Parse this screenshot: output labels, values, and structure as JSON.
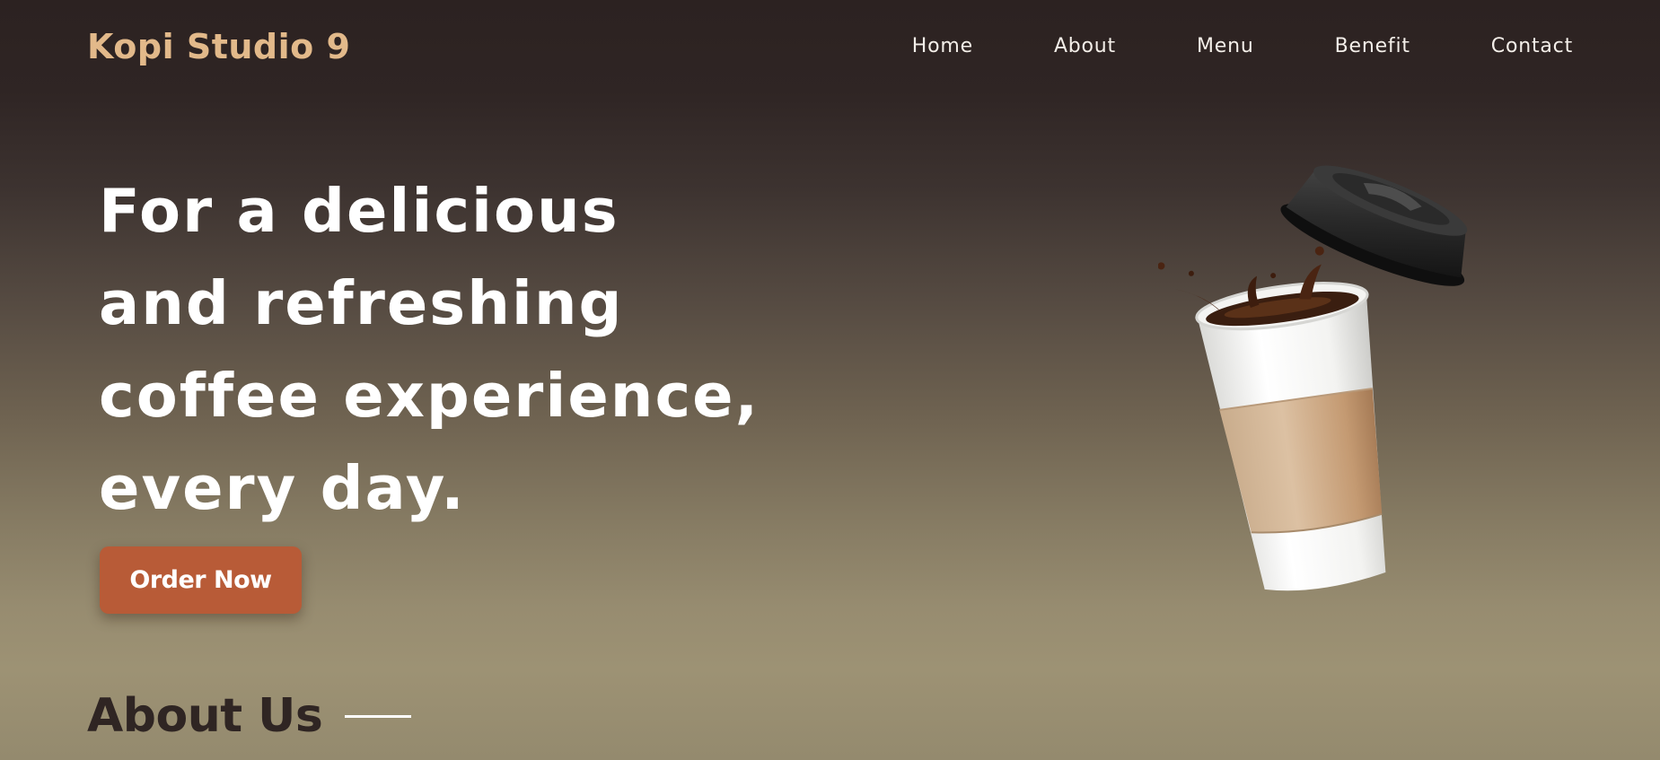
{
  "header": {
    "brand": "Kopi Studio 9",
    "nav": [
      {
        "label": "Home"
      },
      {
        "label": "About"
      },
      {
        "label": "Menu"
      },
      {
        "label": "Benefit"
      },
      {
        "label": "Contact"
      }
    ]
  },
  "hero": {
    "title_lines": [
      "For a delicious",
      "and refreshing",
      "coffee experience,",
      "every day."
    ],
    "cta_label": "Order Now",
    "image": {
      "icon": "coffee-cup-icon"
    }
  },
  "about": {
    "heading": "About Us"
  },
  "colors": {
    "brand": "#e2b98a",
    "accent": "#b85b37",
    "heading_dark": "#2f2523"
  }
}
